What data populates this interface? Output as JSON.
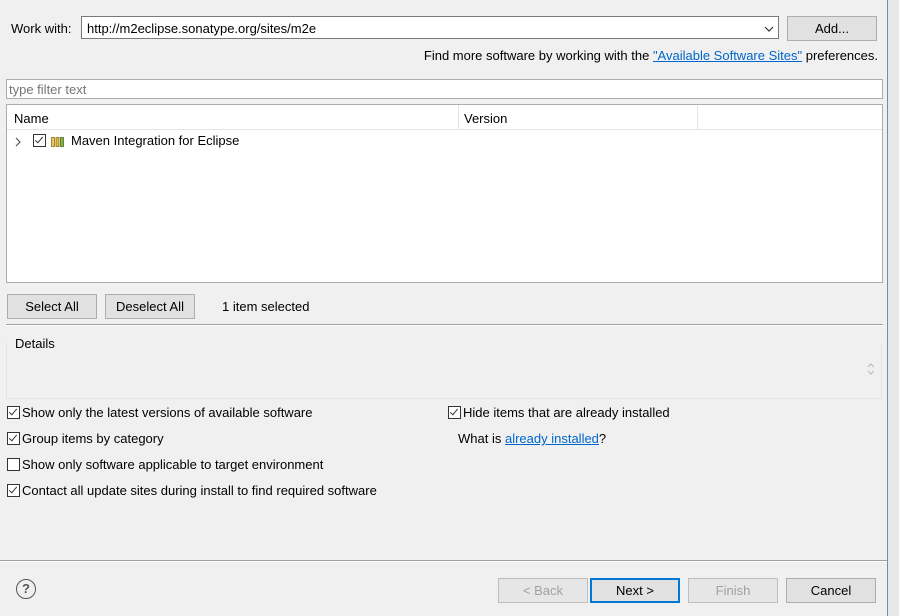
{
  "work_with": {
    "label": "Work with:",
    "value": "http://m2eclipse.sonatype.org/sites/m2e",
    "add_label": "Add..."
  },
  "find_more": {
    "prefix": "Find more software by working with the ",
    "link": "\"Available Software Sites\"",
    "suffix": " preferences."
  },
  "filter": {
    "placeholder": "type filter text"
  },
  "table": {
    "columns": [
      "Name",
      "Version"
    ],
    "rows": [
      {
        "name": "Maven Integration for Eclipse",
        "version": "",
        "checked": true
      }
    ]
  },
  "selection": {
    "select_all": "Select All",
    "deselect_all": "Deselect All",
    "status": "1 item selected"
  },
  "details": {
    "title": "Details"
  },
  "options": {
    "latest_versions": {
      "label": "Show only the latest versions of available software",
      "checked": true
    },
    "group_by_category": {
      "label": "Group items by category",
      "checked": true
    },
    "target_env": {
      "label": "Show only software applicable to target environment",
      "checked": false
    },
    "contact_sites": {
      "label": "Contact all update sites during install to find required software",
      "checked": true
    },
    "hide_installed": {
      "label": "Hide items that are already installed",
      "checked": true
    },
    "what_is": {
      "prefix": "What is ",
      "link": "already installed",
      "suffix": "?"
    }
  },
  "footer": {
    "help": "?",
    "back": "< Back",
    "next": "Next >",
    "finish": "Finish",
    "cancel": "Cancel"
  }
}
